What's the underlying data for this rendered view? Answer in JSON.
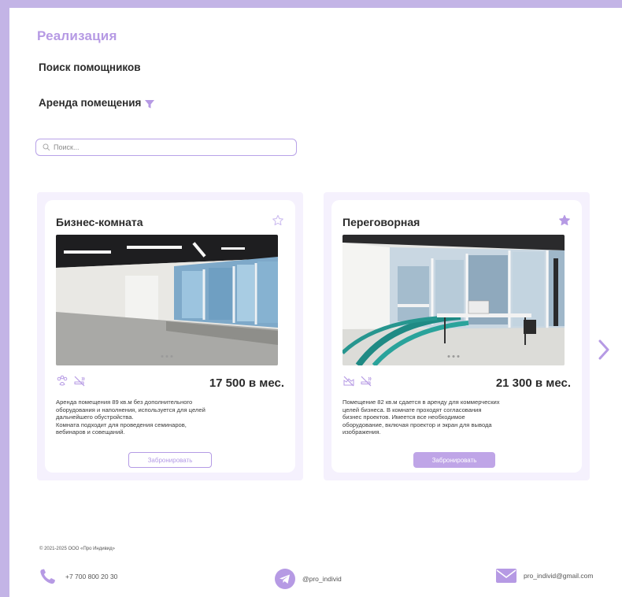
{
  "brand": "Реализация",
  "nav": {
    "item1": "Поиск помощников",
    "item2": "Аренда помещения"
  },
  "search": {
    "placeholder": "Поиск..."
  },
  "cards": [
    {
      "title": "Бизнес-комната",
      "price": "17 500 в мес.",
      "description": "Аренда помещения 89 кв.м без дополнительного\nоборудования и наполнения, используется для целей\nдальнейшего обустройства.\nКомната подходит для проведения семинаров,\nвебинаров и совещаний.",
      "button": "Забронировать",
      "favorite": false,
      "amenities": [
        "pets-allowed-icon",
        "no-smoking-icon"
      ]
    },
    {
      "title": "Переговорная",
      "price": "21 300 в мес.",
      "description": "Помещение 82 кв.м сдается в аренду для коммерческих\nцелей бизнеса. В комнате проходят согласования\nбизнес проектов. Имеется все необходимое\nоборудование, включая проектор и экран для вывода\nизображения.",
      "button": "Забронировать",
      "favorite": true,
      "amenities": [
        "no-pets-icon",
        "no-smoking-icon"
      ]
    }
  ],
  "footer": {
    "copyright": "© 2021-2025 ООО «Про Индивид»",
    "phone": "+7 700 800 20 30",
    "telegram": "@pro_individ",
    "email": "pro_individ@gmail.com"
  },
  "colors": {
    "accent": "#b69ae4",
    "frame": "#c3b4e6",
    "card_bg": "#f5f1fd"
  }
}
